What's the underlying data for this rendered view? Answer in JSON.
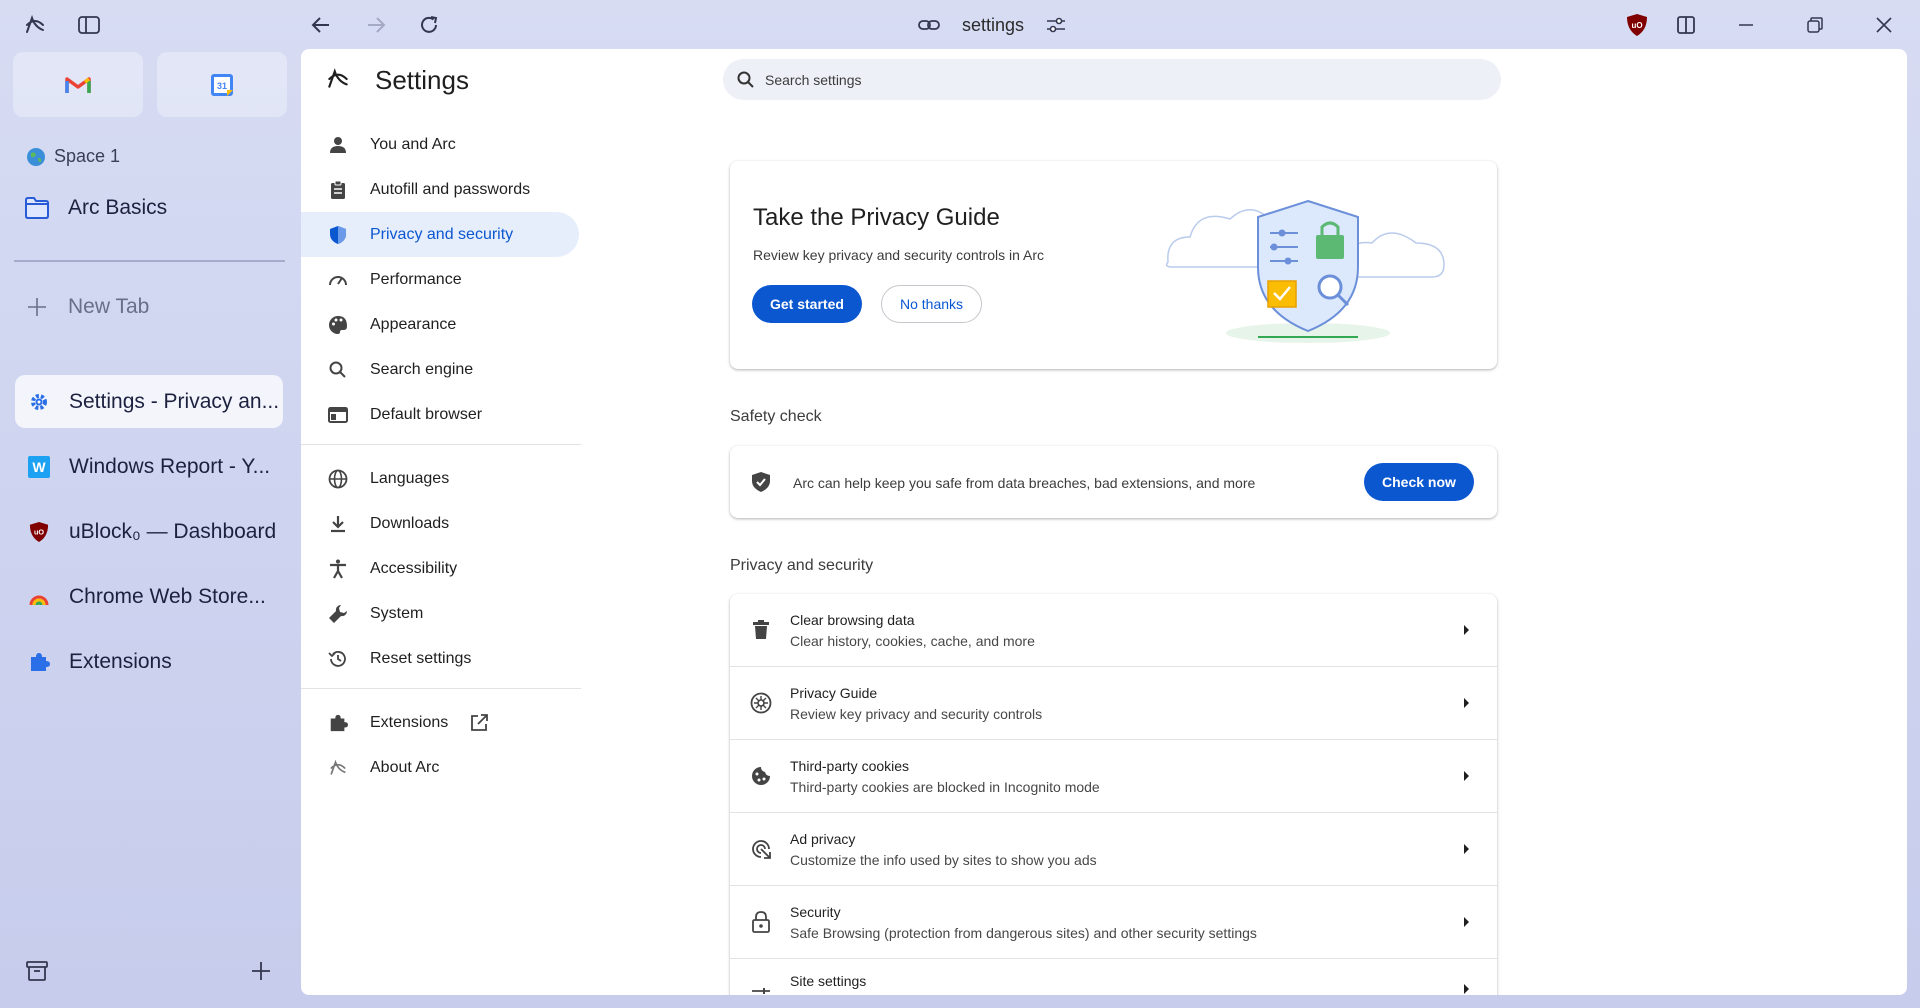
{
  "topbar": {
    "url": "settings"
  },
  "sidebar": {
    "space_name": "Space 1",
    "folder_name": "Arc Basics",
    "new_tab_label": "New Tab",
    "tabs": [
      {
        "label": "Settings - Privacy an...",
        "icon": "gear-icon"
      },
      {
        "label": "Windows Report - Y...",
        "icon": "w-logo-icon"
      },
      {
        "label": "uBlock₀ — Dashboard",
        "icon": "ublock-icon"
      },
      {
        "label": "Chrome Web Store...",
        "icon": "rainbow-icon"
      },
      {
        "label": "Extensions",
        "icon": "puzzle-icon"
      }
    ]
  },
  "settings": {
    "title": "Settings",
    "search_placeholder": "Search settings",
    "nav": [
      {
        "label": "You and Arc"
      },
      {
        "label": "Autofill and passwords"
      },
      {
        "label": "Privacy and security"
      },
      {
        "label": "Performance"
      },
      {
        "label": "Appearance"
      },
      {
        "label": "Search engine"
      },
      {
        "label": "Default browser"
      },
      {
        "label": "Languages"
      },
      {
        "label": "Downloads"
      },
      {
        "label": "Accessibility"
      },
      {
        "label": "System"
      },
      {
        "label": "Reset settings"
      },
      {
        "label": "Extensions"
      },
      {
        "label": "About Arc"
      }
    ]
  },
  "privacy_guide": {
    "title": "Take the Privacy Guide",
    "subtitle": "Review key privacy and security controls in Arc",
    "get_started": "Get started",
    "no_thanks": "No thanks"
  },
  "safety_check": {
    "heading": "Safety check",
    "text": "Arc can help keep you safe from data breaches, bad extensions, and more",
    "button": "Check now"
  },
  "privacy_section": {
    "heading": "Privacy and security",
    "rows": [
      {
        "title": "Clear browsing data",
        "subtitle": "Clear history, cookies, cache, and more"
      },
      {
        "title": "Privacy Guide",
        "subtitle": "Review key privacy and security controls"
      },
      {
        "title": "Third-party cookies",
        "subtitle": "Third-party cookies are blocked in Incognito mode"
      },
      {
        "title": "Ad privacy",
        "subtitle": "Customize the info used by sites to show you ads"
      },
      {
        "title": "Security",
        "subtitle": "Safe Browsing (protection from dangerous sites) and other security settings"
      },
      {
        "title": "Site settings",
        "subtitle": ""
      }
    ]
  },
  "colors": {
    "accent": "#0b57d0",
    "active_nav_bg": "#e6eefc",
    "sidebar_bg": "#cfd5f0"
  }
}
